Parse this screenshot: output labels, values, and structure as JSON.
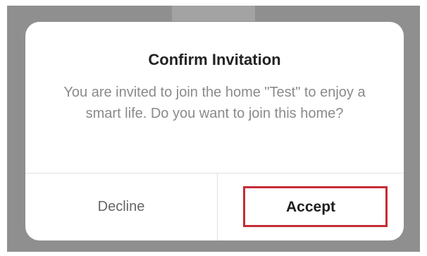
{
  "dialog": {
    "title": "Confirm Invitation",
    "message": "You are invited to join the home \"Test\" to enjoy a smart life. Do you want to join this home?"
  },
  "actions": {
    "decline_label": "Decline",
    "accept_label": "Accept"
  },
  "colors": {
    "overlay": "#8f8f8f",
    "dialog_background": "#ffffff",
    "highlight": "#c52d35"
  }
}
